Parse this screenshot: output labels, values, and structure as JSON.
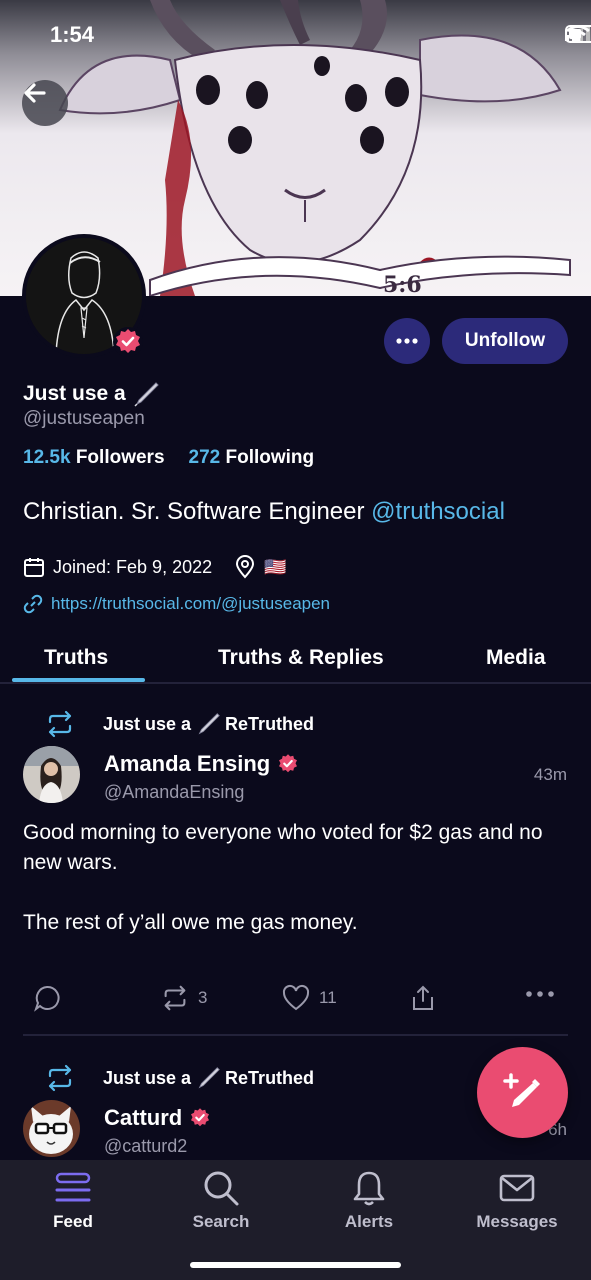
{
  "status_bar": {
    "time": "1:54"
  },
  "profile": {
    "display_name": "Just use a",
    "handle": "@justuseapen",
    "followers_count": "12.5k",
    "followers_label": "Followers",
    "following_count": "272",
    "following_label": "Following",
    "bio_text": "Christian. Sr. Software Engineer",
    "bio_mention": "@truthsocial",
    "joined": "Joined: Feb 9, 2022",
    "location_flag": "🇺🇸",
    "website": "https://truthsocial.com/@justuseapen",
    "unfollow_label": "Unfollow"
  },
  "tabs": [
    {
      "label": "Truths",
      "active": true
    },
    {
      "label": "Truths & Replies",
      "active": false
    },
    {
      "label": "Media",
      "active": false
    }
  ],
  "posts": [
    {
      "retruth_by": "Just use a",
      "retruth_label": "ReTruthed",
      "author_name": "Amanda Ensing",
      "author_handle": "@AmandaEnsing",
      "time": "43m",
      "text": "Good morning to everyone who voted for $2 gas and no new wars.\n\nThe rest of y’all owe me gas money.",
      "retruths": "3",
      "likes": "11"
    },
    {
      "retruth_by": "Just use a",
      "retruth_label": "ReTruthed",
      "author_name": "Catturd",
      "author_handle": "@catturd2",
      "time": "6h"
    }
  ],
  "bottom_nav": [
    {
      "label": "Feed",
      "icon": "feed-icon",
      "active": true
    },
    {
      "label": "Search",
      "icon": "search-icon",
      "active": false
    },
    {
      "label": "Alerts",
      "icon": "bell-icon",
      "active": false
    },
    {
      "label": "Messages",
      "icon": "mail-icon",
      "active": false
    }
  ],
  "colors": {
    "background": "#0b0a1c",
    "accent": "#58b8e8",
    "button": "#2c2a7a",
    "fab": "#ea4c71",
    "verified": "#ea4c71"
  }
}
